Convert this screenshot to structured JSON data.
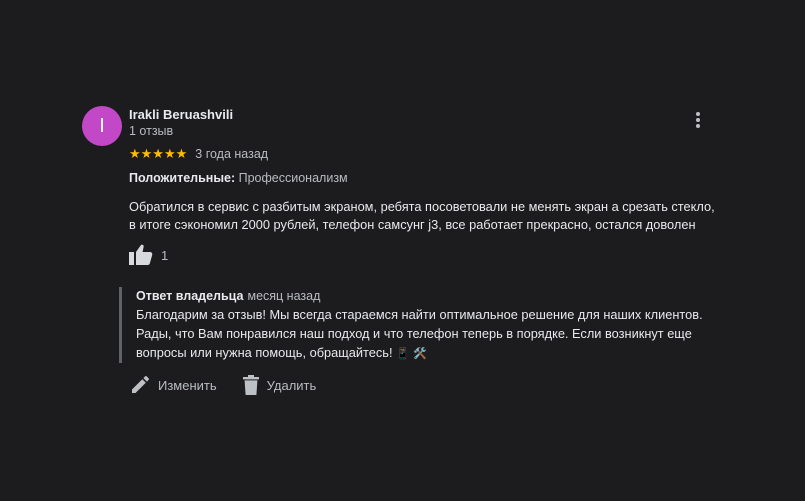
{
  "review": {
    "avatar_letter": "I",
    "author": "Irakli Beruashvili",
    "review_count": "1 отзыв",
    "stars": "★★★★★",
    "rating": 5,
    "time": "3 года назад",
    "positive_label": "Положительные:",
    "positive_value": "Профессионализм",
    "text_line1": "Обратился в сервис с разбитым экраном, ребята посоветовали не менять экран а срезать стекло,",
    "text_line2": "в итоге сэкономил 2000 рублей, телефон самсунг j3, все работает прекрасно, остался доволен",
    "likes": "1"
  },
  "owner_reply": {
    "label": "Ответ владельца",
    "time": "месяц назад",
    "line1": "Благодарим за отзыв! Мы всегда стараемся найти оптимальное решение для наших клиентов.",
    "line2": "Рады, что Вам понравился наш подход и что телефон теперь в порядке. Если возникнут еще",
    "line3": "вопросы или нужна помощь, обращайтесь!",
    "emojis": "📱 🛠️"
  },
  "actions": {
    "edit_label": "Изменить",
    "delete_label": "Удалить"
  },
  "colors": {
    "background": "#1c1b1d",
    "avatar": "#c348c7",
    "star": "#fbbc04"
  }
}
